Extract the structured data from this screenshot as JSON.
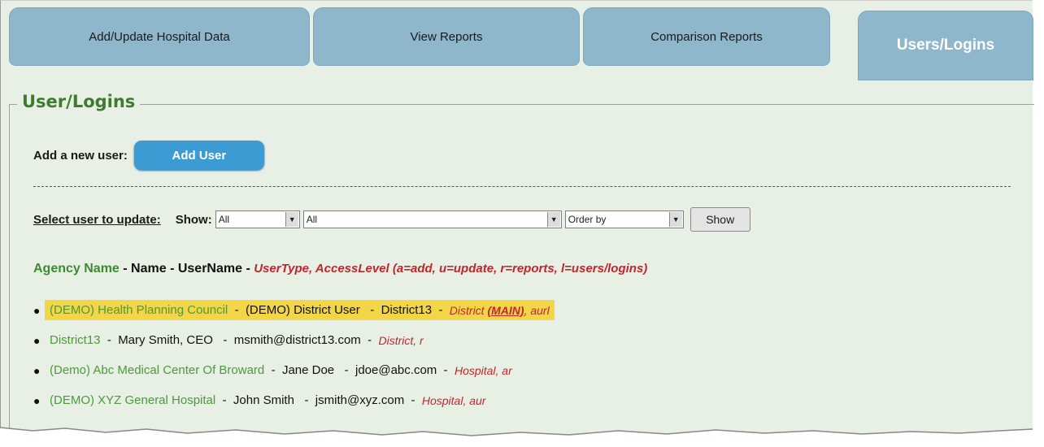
{
  "tabs": [
    {
      "label": "Add/Update Hospital Data"
    },
    {
      "label": "View Reports"
    },
    {
      "label": "Comparison Reports"
    },
    {
      "label": "Users/Logins"
    }
  ],
  "section_title": "User/Logins",
  "add": {
    "label": "Add a new user:",
    "button": "Add User"
  },
  "select": {
    "label": "Select user to update:",
    "show_label": "Show:",
    "dropdown1": "All",
    "dropdown2": "All",
    "dropdown3": "Order by",
    "show_button": "Show"
  },
  "header": {
    "agency": "Agency Name",
    "sep1": " - ",
    "name": "Name",
    "sep2": " - ",
    "username": "UserName",
    "sep3": " - ",
    "type": "UserType, AccessLevel (a=add, u=update, r=reports, l=users/logins)"
  },
  "users": [
    {
      "agency": "(DEMO) Health Planning Council",
      "name": "(DEMO) District User",
      "username": "District13",
      "type": "District",
      "main": "(MAIN)",
      "access": ", aurl"
    },
    {
      "agency": "District13",
      "name": "Mary Smith, CEO",
      "username": "msmith@district13.com",
      "type": "District, r"
    },
    {
      "agency": "(Demo) Abc Medical Center Of Broward",
      "name": "Jane Doe",
      "username": "jdoe@abc.com",
      "type": "Hospital, ar"
    },
    {
      "agency": "(DEMO) XYZ General Hospital",
      "name": "John Smith",
      "username": "jsmith@xyz.com",
      "type": "Hospital, aur"
    }
  ],
  "colors": {
    "accent": "#3c9bd3",
    "tab": "#8fb7cb",
    "panel": "#e8efe4",
    "highlight": "#f3d548",
    "agency": "#4b9a3c",
    "usertype": "#c0262c"
  }
}
